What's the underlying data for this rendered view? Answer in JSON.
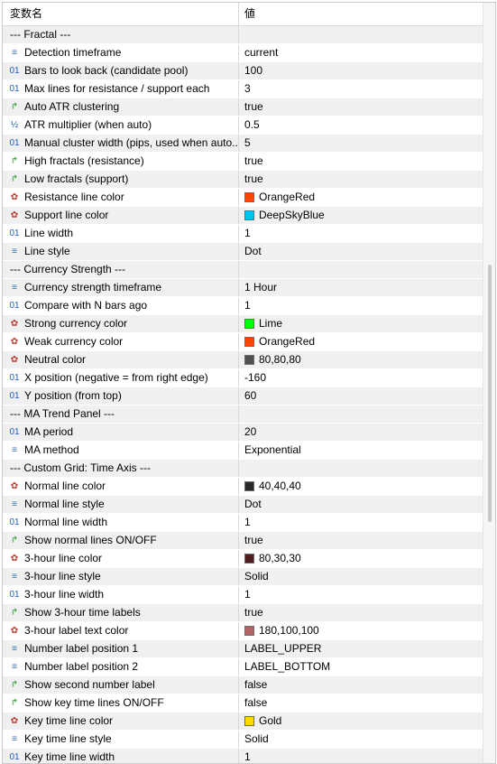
{
  "header": {
    "col_name": "変数名",
    "col_value": "値"
  },
  "rows": [
    {
      "type": "section",
      "label": "--- Fractal ---",
      "value": ""
    },
    {
      "icon": "enum",
      "label": "Detection timeframe",
      "value": "current"
    },
    {
      "icon": "int",
      "label": "Bars to look back (candidate pool)",
      "value": "100"
    },
    {
      "icon": "int",
      "label": "Max lines for resistance / support each",
      "value": "3"
    },
    {
      "icon": "bool",
      "label": "Auto ATR clustering",
      "value": "true"
    },
    {
      "icon": "double",
      "label": "ATR multiplier (when auto)",
      "value": "0.5"
    },
    {
      "icon": "int",
      "label": "Manual cluster width (pips, used when auto...",
      "value": "5"
    },
    {
      "icon": "bool",
      "label": "High fractals (resistance)",
      "value": "true"
    },
    {
      "icon": "bool",
      "label": "Low fractals (support)",
      "value": "true"
    },
    {
      "icon": "color",
      "label": "Resistance line color",
      "value": "OrangeRed",
      "color": "#ff4500"
    },
    {
      "icon": "color",
      "label": "Support line color",
      "value": "DeepSkyBlue",
      "color": "#00bfff"
    },
    {
      "icon": "int",
      "label": "Line width",
      "value": "1"
    },
    {
      "icon": "enum",
      "label": "Line style",
      "value": "Dot"
    },
    {
      "type": "section",
      "label": "--- Currency Strength ---",
      "value": ""
    },
    {
      "icon": "enum",
      "label": "Currency strength timeframe",
      "value": "1 Hour"
    },
    {
      "icon": "int",
      "label": "Compare with N bars ago",
      "value": "1"
    },
    {
      "icon": "color",
      "label": "Strong currency color",
      "value": "Lime",
      "color": "#00ff00"
    },
    {
      "icon": "color",
      "label": "Weak currency color",
      "value": "OrangeRed",
      "color": "#ff4500"
    },
    {
      "icon": "color",
      "label": "Neutral color",
      "value": "80,80,80",
      "color": "#505050"
    },
    {
      "icon": "int",
      "label": "X position (negative = from right edge)",
      "value": "-160"
    },
    {
      "icon": "int",
      "label": "Y position (from top)",
      "value": "60"
    },
    {
      "type": "section",
      "label": "--- MA Trend Panel ---",
      "value": ""
    },
    {
      "icon": "int",
      "label": "MA period",
      "value": "20"
    },
    {
      "icon": "enum",
      "label": "MA method",
      "value": "Exponential"
    },
    {
      "type": "section",
      "label": "--- Custom Grid: Time Axis ---",
      "value": ""
    },
    {
      "icon": "color",
      "label": "Normal line color",
      "value": "40,40,40",
      "color": "#282828"
    },
    {
      "icon": "enum",
      "label": "Normal line style",
      "value": "Dot"
    },
    {
      "icon": "int",
      "label": "Normal line width",
      "value": "1"
    },
    {
      "icon": "bool",
      "label": "Show normal lines ON/OFF",
      "value": "true"
    },
    {
      "icon": "color",
      "label": "3-hour line color",
      "value": "80,30,30",
      "color": "#501e1e"
    },
    {
      "icon": "enum",
      "label": "3-hour line style",
      "value": "Solid"
    },
    {
      "icon": "int",
      "label": "3-hour line width",
      "value": "1"
    },
    {
      "icon": "bool",
      "label": "Show 3-hour time labels",
      "value": "true"
    },
    {
      "icon": "color",
      "label": "3-hour label text color",
      "value": "180,100,100",
      "color": "#b46464"
    },
    {
      "icon": "enum",
      "label": "Number label position 1",
      "value": "LABEL_UPPER"
    },
    {
      "icon": "enum",
      "label": "Number label position 2",
      "value": "LABEL_BOTTOM"
    },
    {
      "icon": "bool",
      "label": "Show second number label",
      "value": "false"
    },
    {
      "icon": "bool",
      "label": "Show key time lines ON/OFF",
      "value": "false"
    },
    {
      "icon": "color",
      "label": "Key time line color",
      "value": "Gold",
      "color": "#ffd700"
    },
    {
      "icon": "enum",
      "label": "Key time line style",
      "value": "Solid"
    },
    {
      "icon": "int",
      "label": "Key time line width",
      "value": "1"
    }
  ]
}
